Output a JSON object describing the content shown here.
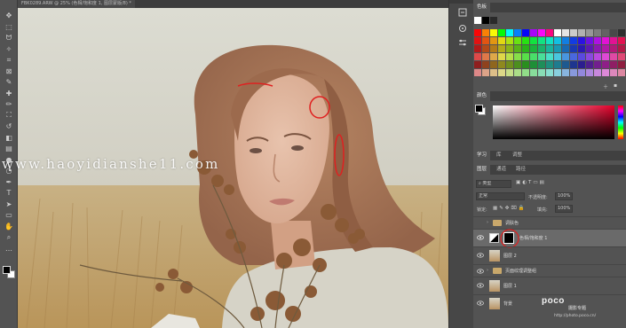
{
  "document": {
    "tab_title": "FBK0289.ARW @ 25% (色相/饱和度 1, 图层蒙版/8) *"
  },
  "watermark": {
    "text": "www.haoyidianshe11.com"
  },
  "panels": {
    "swatches_tab": "色板",
    "color_tab": "颜色",
    "learn_tab": "学习",
    "libraries_tab": "库",
    "adjustments_tab": "调整",
    "layers_tab": "图层",
    "channels_tab": "通道",
    "paths_tab": "路径",
    "filter_kind": "类型",
    "blend_mode": "正常",
    "opacity_label": "不透明度:",
    "opacity_value": "100%",
    "lock_label": "锁定:",
    "fill_label": "填充:",
    "fill_value": "100%"
  },
  "layers": [
    {
      "name": "调肤色",
      "kind": "group",
      "visible": false
    },
    {
      "name": "色相/饱和度 1",
      "kind": "adjustment",
      "visible": true,
      "selected": true
    },
    {
      "name": "图层 2",
      "kind": "pixel",
      "visible": true
    },
    {
      "name": "页面纹理调整组",
      "kind": "group",
      "visible": true
    },
    {
      "name": "图层 1",
      "kind": "pixel",
      "visible": true
    },
    {
      "name": "背景",
      "kind": "pixel",
      "visible": true
    }
  ],
  "branding": {
    "logo": "poco",
    "subtitle": "摄影专题",
    "url": "http://photo.poco.cn/"
  },
  "colors": {
    "foreground": "#000000",
    "background": "#ffffff",
    "accent_annotation": "#e02020",
    "panel_bg": "#535353",
    "selected_layer": "#6a6a6a"
  },
  "icons": {
    "tools": [
      "move-icon",
      "marquee-icon",
      "lasso-icon",
      "quick-select-icon",
      "crop-icon",
      "frame-icon",
      "eyedropper-icon",
      "healing-icon",
      "brush-icon",
      "stamp-icon",
      "history-brush-icon",
      "eraser-icon",
      "gradient-icon",
      "blur-icon",
      "dodge-icon",
      "pen-icon",
      "type-icon",
      "path-select-icon",
      "shape-icon",
      "hand-icon",
      "zoom-icon",
      "more-tools-icon"
    ]
  }
}
